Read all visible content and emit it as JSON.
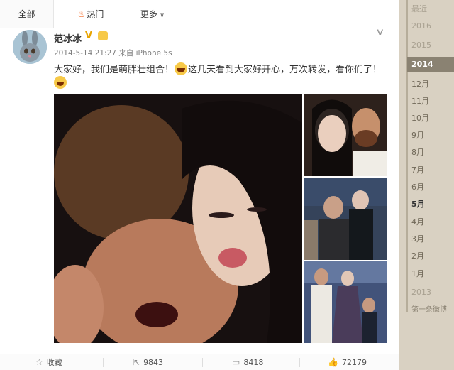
{
  "tabs": {
    "all": "全部",
    "hot": "热门",
    "more": "更多"
  },
  "post": {
    "username": "范冰冰",
    "verified_badge": "V",
    "meta": "2014-5-14 21:27 来自 iPhone 5s",
    "text_part1": "大家好，我们是萌胖壮组合！",
    "text_part2": "这几天看到大家好开心，万次转发，看你们了！",
    "photos": [
      "main-photo",
      "side-photo-1",
      "side-photo-2",
      "side-photo-3"
    ]
  },
  "actions": {
    "favorite_label": "收藏",
    "forward_count": "9843",
    "comment_count": "8418",
    "like_count": "72179"
  },
  "timeline": {
    "recent": "最近",
    "years": [
      "2016",
      "2015",
      "2014"
    ],
    "months": [
      "12月",
      "11月",
      "10月",
      "9月",
      "8月",
      "7月",
      "6月",
      "5月",
      "4月",
      "3月",
      "2月",
      "1月"
    ],
    "year_2013": "2013",
    "first_post": "第一条微博"
  },
  "colors": {
    "accent": "#f56e2c",
    "timeline_bg": "#d9d1c2",
    "timeline_active": "#8a8272"
  }
}
